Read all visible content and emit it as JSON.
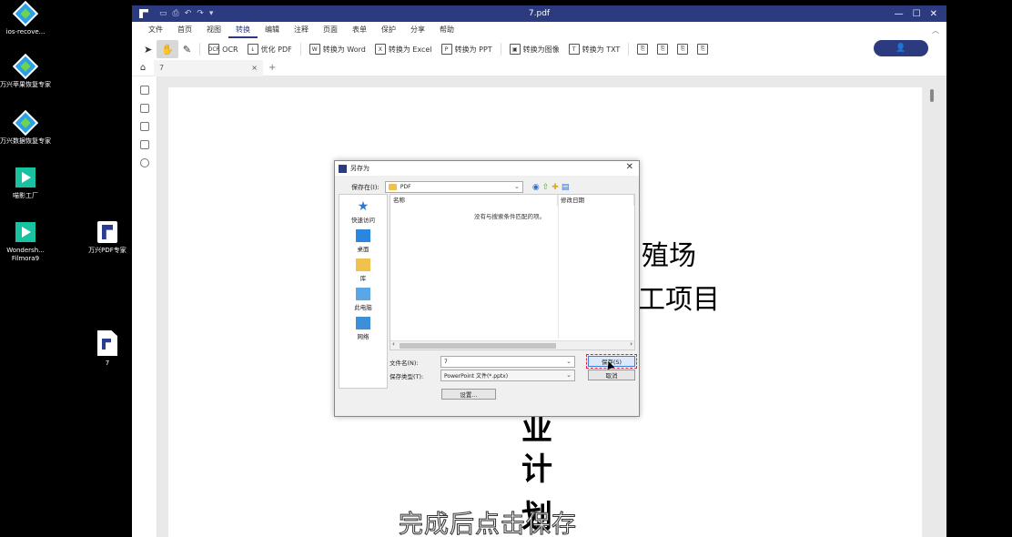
{
  "desktop": {
    "icons": [
      {
        "label": "ios-recove..."
      },
      {
        "label": "万兴苹果恢复专家"
      },
      {
        "label": "万兴数据恢复专家"
      },
      {
        "label": "喵影工厂"
      },
      {
        "label": "Wondersh... Filmora9"
      },
      {
        "label": "万兴PDF专家"
      },
      {
        "label": "7"
      }
    ]
  },
  "window": {
    "title": "7.pdf",
    "controls": {
      "minimize": "—",
      "maximize": "☐",
      "close": "✕"
    }
  },
  "menu": {
    "items": [
      "文件",
      "首页",
      "视图",
      "转换",
      "编辑",
      "注释",
      "页面",
      "表单",
      "保护",
      "分享",
      "帮助"
    ],
    "active": "转换"
  },
  "toolbar": {
    "ocr": "OCR",
    "optimize": "优化 PDF",
    "to_word": "转换为 Word",
    "to_excel": "转换为 Excel",
    "to_ppt": "转换为 PPT",
    "to_image": "转换为图像",
    "to_txt": "转换为 TXT",
    "user_icon": "👤"
  },
  "tabs": {
    "doc_tab": "7",
    "close": "×",
    "add": "+"
  },
  "document": {
    "line1": "殖场",
    "line2": "加工项目",
    "line3": "业",
    "line4": "计",
    "line5": "划"
  },
  "dialog": {
    "title": "另存为",
    "save_in_label": "保存在(I):",
    "save_in_value": "PDF",
    "places": [
      "快速访问",
      "桌面",
      "库",
      "此电脑",
      "网络"
    ],
    "col_name": "名称",
    "col_date": "修改日期",
    "empty_msg": "没有与搜索条件匹配的项。",
    "filename_label": "文件名(N):",
    "filename_value": "7",
    "filetype_label": "保存类型(T):",
    "filetype_value": "PowerPoint 文件(*.pptx)",
    "save_btn": "保存(S)",
    "cancel_btn": "取消",
    "settings_btn": "设置..."
  },
  "caption": "完成后点击保存",
  "colors": {
    "brand": "#2c3a7f",
    "folder": "#f1c14e"
  }
}
